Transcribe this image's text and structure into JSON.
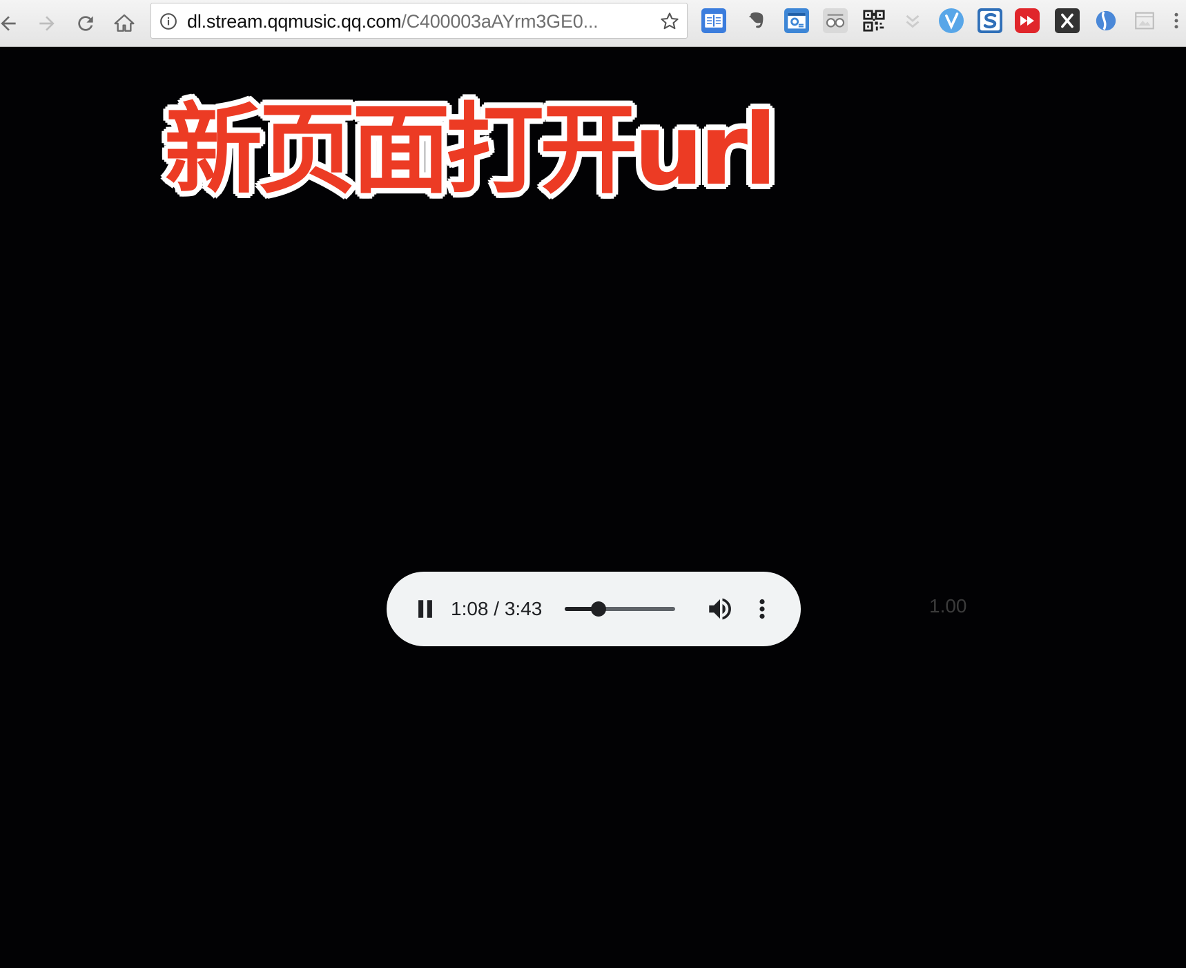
{
  "browser": {
    "url_host": "dl.stream.qqmusic.qq.com",
    "url_path": "/C400003aAYrm3GE0...",
    "nav": {
      "back_icon": "arrow-left-icon",
      "forward_icon": "arrow-right-icon",
      "reload_icon": "reload-icon",
      "home_icon": "home-icon"
    },
    "extensions": [
      {
        "name": "reader-extension",
        "icon": "book-icon",
        "color": "#3b7ddd"
      },
      {
        "name": "evernote-extension",
        "icon": "elephant-icon",
        "color": "#5a5a5a"
      },
      {
        "name": "settings-extension",
        "icon": "gear-window-icon",
        "color": "#3d86d6"
      },
      {
        "name": "glasses-extension",
        "icon": "glasses-icon",
        "color": "#888888"
      },
      {
        "name": "qr-code-extension",
        "icon": "qr-code-icon",
        "color": "#222222"
      },
      {
        "name": "download-extension",
        "icon": "chevron-down-icon",
        "color": "#cccccc"
      },
      {
        "name": "v-extension",
        "icon": "v-icon",
        "color": "#58a6e8"
      },
      {
        "name": "s-extension",
        "icon": "s-icon",
        "color": "#2f6fb8"
      },
      {
        "name": "youtube-extension",
        "icon": "fast-forward-icon",
        "color": "#e0262b"
      },
      {
        "name": "x-extension",
        "icon": "x-icon",
        "color": "#333333"
      },
      {
        "name": "sphere-extension",
        "icon": "sphere-icon",
        "color": "#4a88d8"
      },
      {
        "name": "screenshot-extension",
        "icon": "image-icon",
        "color": "#bdbdbd"
      }
    ]
  },
  "caption": {
    "text": "新页面打开url"
  },
  "player": {
    "time_display": "1:08 / 3:43",
    "current_seconds": 68,
    "duration_seconds": 223,
    "state": "playing",
    "pause_icon": "pause-icon",
    "volume_icon": "volume-icon",
    "more_icon": "more-vertical-icon"
  },
  "playback_rate": "1.00"
}
